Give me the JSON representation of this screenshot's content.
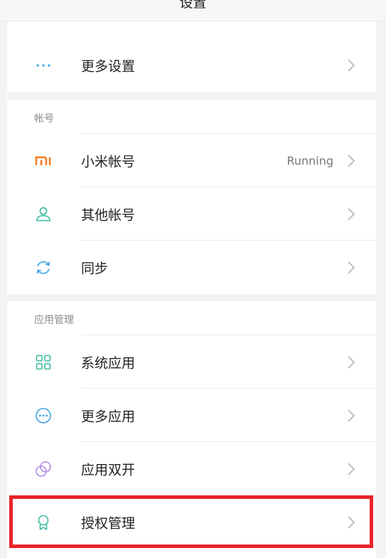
{
  "topbar": {
    "title": "设置"
  },
  "rows": {
    "more_settings": {
      "label": "更多设置",
      "icon": "ellipsis-icon"
    },
    "mi_account": {
      "label": "小米帐号",
      "value": "Running",
      "icon": "mi-logo-icon"
    },
    "other_accounts": {
      "label": "其他帐号",
      "icon": "person-icon"
    },
    "sync": {
      "label": "同步",
      "icon": "sync-icon"
    },
    "system_apps": {
      "label": "系统应用",
      "icon": "grid-icon"
    },
    "more_apps": {
      "label": "更多应用",
      "icon": "more-circle-icon"
    },
    "dual_apps": {
      "label": "应用双开",
      "icon": "dual-circle-icon"
    },
    "permissions": {
      "label": "授权管理",
      "icon": "ribbon-icon"
    }
  },
  "sections": {
    "accounts": {
      "title": "帐号"
    },
    "app_management": {
      "title": "应用管理"
    }
  },
  "colors": {
    "accent_blue": "#3aa0e6",
    "mi_orange": "#f57d23",
    "teal": "#3cb8a0",
    "purple": "#b08be6",
    "highlight_red": "#e8242b"
  }
}
